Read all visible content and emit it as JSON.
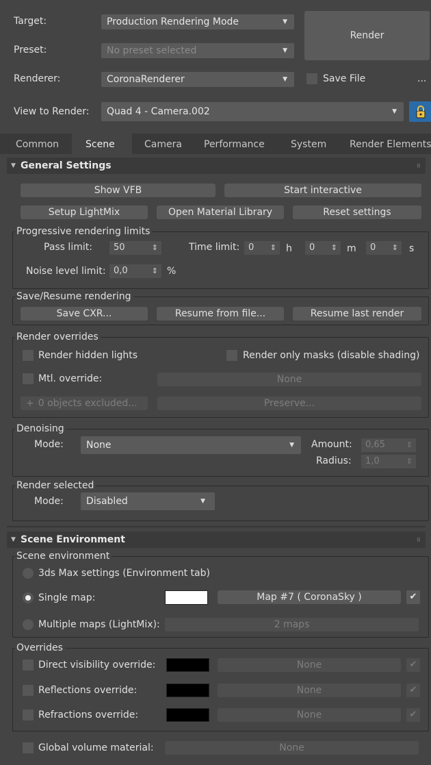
{
  "top": {
    "target_label": "Target:",
    "target_value": "Production Rendering Mode",
    "preset_label": "Preset:",
    "preset_value": "No preset selected",
    "renderer_label": "Renderer:",
    "renderer_value": "CoronaRenderer",
    "render_button": "Render",
    "save_file_label": "Save File",
    "save_file_dots": "...",
    "view_label": "View to Render:",
    "view_value": "Quad 4 - Camera.002"
  },
  "tabs": [
    "Common",
    "Scene",
    "Camera",
    "Performance",
    "System",
    "Render Elements"
  ],
  "active_tab": "Scene",
  "general": {
    "title": "General Settings",
    "show_vfb": "Show VFB",
    "start_interactive": "Start interactive",
    "setup_lightmix": "Setup LightMix",
    "open_material_library": "Open Material Library",
    "reset_settings": "Reset settings",
    "progressive": {
      "title": "Progressive rendering limits",
      "pass_limit_label": "Pass limit:",
      "pass_limit_value": "50",
      "time_limit_label": "Time limit:",
      "time_h": "0",
      "h_unit": "h",
      "time_m": "0",
      "m_unit": "m",
      "time_s": "0",
      "s_unit": "s",
      "noise_label": "Noise level limit:",
      "noise_value": "0,0",
      "noise_unit": "%"
    },
    "save_resume": {
      "title": "Save/Resume rendering",
      "save_cxr": "Save CXR...",
      "resume_from_file": "Resume from file...",
      "resume_last": "Resume last render"
    },
    "overrides": {
      "title": "Render overrides",
      "render_hidden_lights": "Render hidden lights",
      "render_only_masks": "Render only masks (disable shading)",
      "mtl_override": "Mtl. override:",
      "mtl_value": "None",
      "excluded_plus": "+",
      "excluded": "0 objects excluded...",
      "preserve": "Preserve..."
    },
    "denoising": {
      "title": "Denoising",
      "mode_label": "Mode:",
      "mode_value": "None",
      "amount_label": "Amount:",
      "amount_value": "0,65",
      "radius_label": "Radius:",
      "radius_value": "1,0"
    },
    "render_selected": {
      "title": "Render selected",
      "mode_label": "Mode:",
      "mode_value": "Disabled"
    }
  },
  "environment": {
    "title": "Scene Environment",
    "group_title": "Scene environment",
    "max_settings": "3ds Max settings (Environment tab)",
    "single_map": "Single map:",
    "single_map_button": "Map #7  ( CoronaSky )",
    "multiple_maps": "Multiple maps (LightMix):",
    "multiple_maps_button": "2 maps",
    "single_map_color": "#ffffff",
    "overrides_title": "Overrides",
    "direct_visibility": "Direct visibility override:",
    "reflections": "Reflections override:",
    "refractions": "Refractions override:",
    "override_value": "None",
    "override_color": "#000000",
    "global_volume": "Global volume material:",
    "global_volume_value": "None",
    "check_mark": "✔"
  }
}
